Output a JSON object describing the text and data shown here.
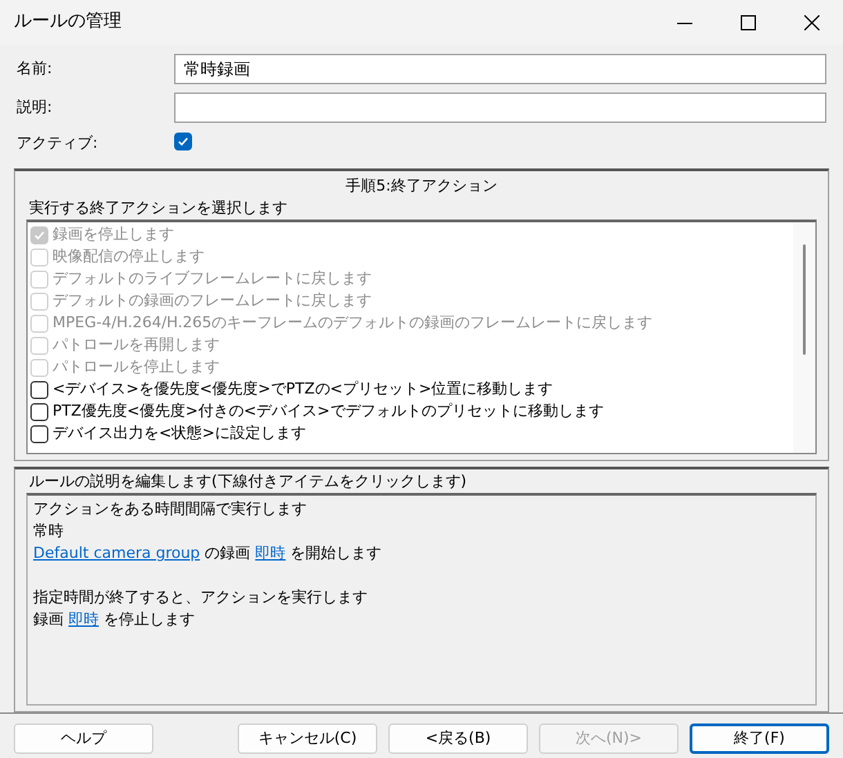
{
  "window": {
    "title": "ルールの管理"
  },
  "fields": [
    {
      "kind": "text",
      "label": "名前:",
      "value": "常時録画"
    },
    {
      "kind": "text",
      "label": "説明:"
    },
    {
      "kind": "checkbox",
      "label": "アクティブ:",
      "checked": true
    }
  ],
  "actions_panel": {
    "heading": "手順5:終了アクション",
    "prompt": "実行する終了アクションを選択します",
    "items": [
      {
        "label": "録画を停止します",
        "checked": true,
        "disabled": true
      },
      {
        "label": "映像配信の停止します",
        "checked": false,
        "disabled": true
      },
      {
        "label": "デフォルトのライブフレームレートに戻します",
        "checked": false,
        "disabled": true
      },
      {
        "label": "デフォルトの録画のフレームレートに戻します",
        "checked": false,
        "disabled": true
      },
      {
        "label": "MPEG-4/H.264/H.265のキーフレームのデフォルトの録画のフレームレートに戻します",
        "checked": false,
        "disabled": true
      },
      {
        "label": "パトロールを再開します",
        "checked": false,
        "disabled": true
      },
      {
        "label": "パトロールを停止します",
        "checked": false,
        "disabled": true
      },
      {
        "label": "<デバイス>を優先度<優先度>でPTZの<プリセット>位置に移動します",
        "checked": false,
        "disabled": false
      },
      {
        "label": "PTZ優先度<優先度>付きの<デバイス>でデフォルトのプリセットに移動します",
        "checked": false,
        "disabled": false
      },
      {
        "label": "デバイス出力を<状態>に設定します",
        "checked": false,
        "disabled": false
      }
    ]
  },
  "description_panel": {
    "heading": "ルールの説明を編集します(下線付きアイテムをクリックします)",
    "paragraphs": [
      [
        [
          {
            "kind": "text",
            "text": "アクションをある時間間隔で実行します"
          }
        ],
        [
          {
            "kind": "text",
            "text": "常時"
          }
        ],
        [
          {
            "kind": "link",
            "text": "Default camera group"
          },
          {
            "kind": "text",
            "text": " の録画 "
          },
          {
            "kind": "link",
            "text": "即時"
          },
          {
            "kind": "text",
            "text": " を開始します"
          }
        ]
      ],
      [
        [
          {
            "kind": "text",
            "text": "指定時間が終了すると、アクションを実行します"
          }
        ],
        [
          {
            "kind": "text",
            "text": "録画 "
          },
          {
            "kind": "link",
            "text": "即時"
          },
          {
            "kind": "text",
            "text": " を停止します"
          }
        ]
      ]
    ]
  },
  "buttons": [
    {
      "label": "ヘルプ",
      "disabled": false,
      "default": false
    },
    {
      "label": "キャンセル(C)",
      "disabled": false,
      "default": false
    },
    {
      "label": "<戻る(B)",
      "disabled": false,
      "default": false
    },
    {
      "label": "次へ(N)>",
      "disabled": true,
      "default": false
    },
    {
      "label": "終了(F)",
      "disabled": false,
      "default": true
    }
  ]
}
